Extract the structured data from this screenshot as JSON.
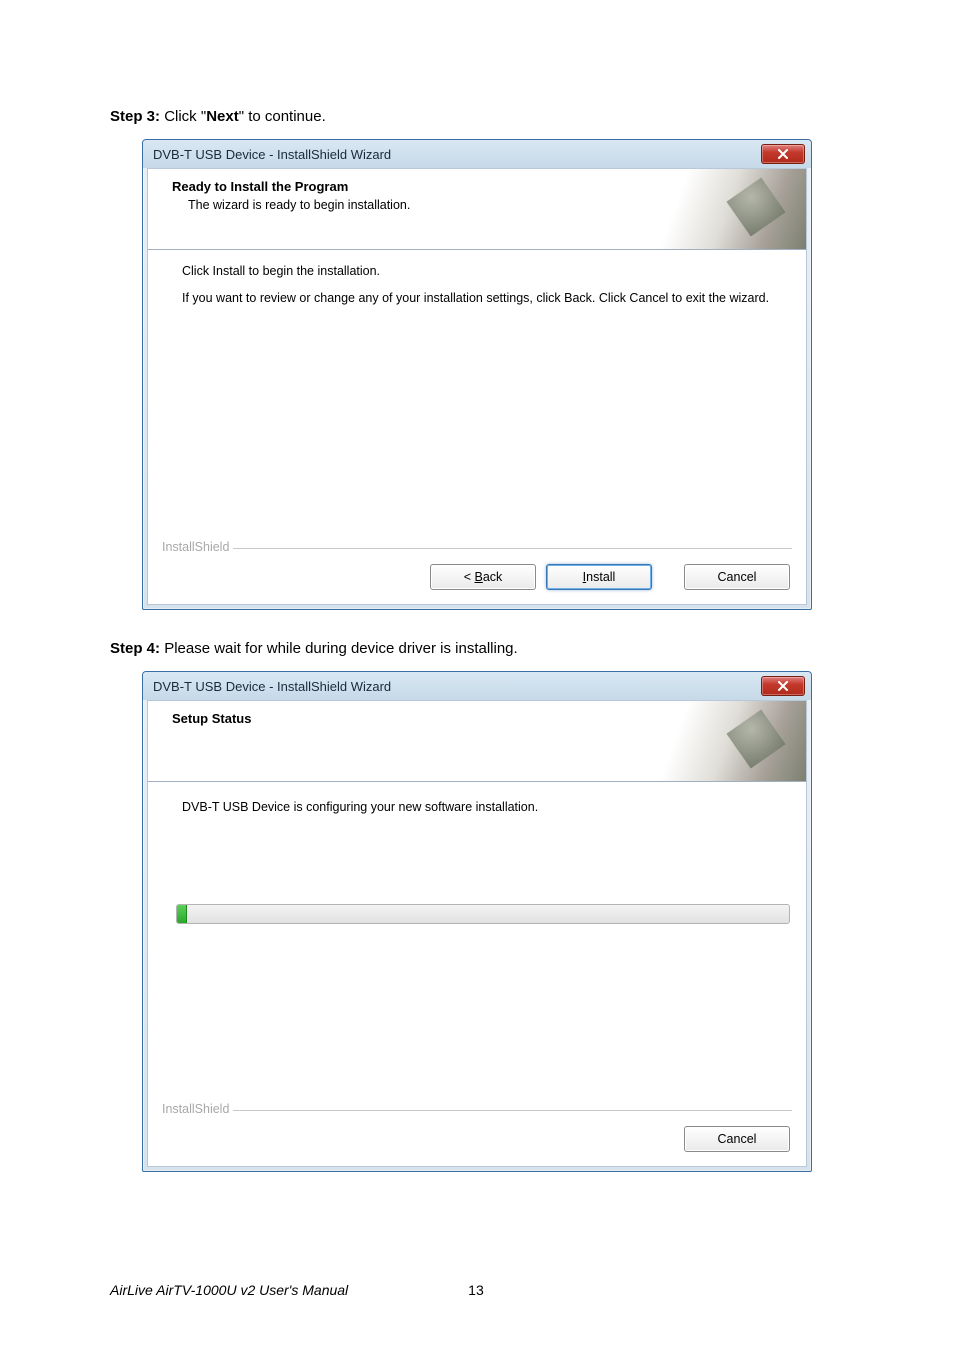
{
  "step3": {
    "prefix": "Step 3: ",
    "mid1": "Click \"",
    "bold": "Next",
    "mid2": "\" to continue."
  },
  "step4": {
    "prefix": "Step 4: ",
    "rest": "Please wait for while during device driver is installing."
  },
  "dialog1": {
    "title": "DVB-T USB Device - InstallShield Wizard",
    "header_title": "Ready to Install the Program",
    "header_sub": "The wizard is ready to begin installation.",
    "body_line1": "Click Install to begin the installation.",
    "body_line2": "If you want to review or change any of your installation settings, click Back. Click Cancel to exit the wizard.",
    "brand": "InstallShield",
    "btn_back": "< Back",
    "btn_install": "Install",
    "btn_cancel": "Cancel"
  },
  "dialog2": {
    "title": "DVB-T USB Device - InstallShield Wizard",
    "header_title": "Setup Status",
    "body_line1": "DVB-T USB Device is configuring your new software installation.",
    "brand": "InstallShield",
    "btn_cancel": "Cancel",
    "progress_percent": 1.5
  },
  "footer": {
    "manual": "AirLive AirTV-1000U v2 User's Manual",
    "page": "13"
  }
}
